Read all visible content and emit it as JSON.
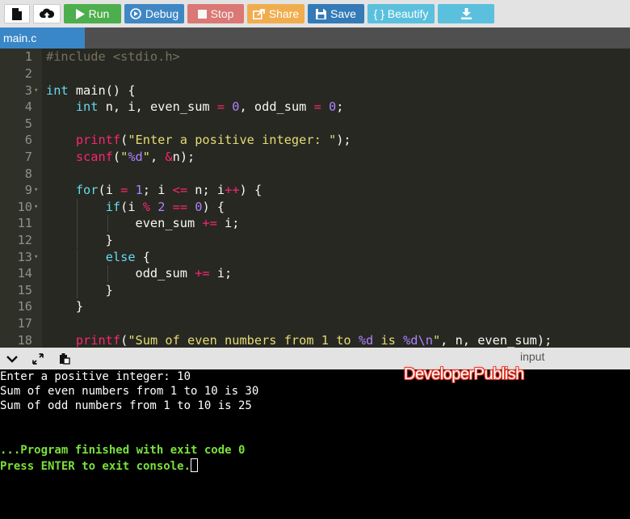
{
  "toolbar": {
    "run_label": "Run",
    "debug_label": "Debug",
    "stop_label": "Stop",
    "share_label": "Share",
    "save_label": "Save",
    "beautify_label": "{ } Beautify"
  },
  "tabs": [
    {
      "label": "main.c"
    }
  ],
  "editor": {
    "lines": [
      {
        "num": "1",
        "code": "#include <stdio.h>"
      },
      {
        "num": "2",
        "code": ""
      },
      {
        "num": "3",
        "code": "int main() {"
      },
      {
        "num": "4",
        "code": "    int n, i, even_sum = 0, odd_sum = 0;"
      },
      {
        "num": "5",
        "code": ""
      },
      {
        "num": "6",
        "code": "    printf(\"Enter a positive integer: \");"
      },
      {
        "num": "7",
        "code": "    scanf(\"%d\", &n);"
      },
      {
        "num": "8",
        "code": ""
      },
      {
        "num": "9",
        "code": "    for(i = 1; i <= n; i++) {"
      },
      {
        "num": "10",
        "code": "        if(i % 2 == 0) {"
      },
      {
        "num": "11",
        "code": "            even_sum += i;"
      },
      {
        "num": "12",
        "code": "        }"
      },
      {
        "num": "13",
        "code": "        else {"
      },
      {
        "num": "14",
        "code": "            odd_sum += i;"
      },
      {
        "num": "15",
        "code": "        }"
      },
      {
        "num": "16",
        "code": "    }"
      },
      {
        "num": "17",
        "code": ""
      },
      {
        "num": "18",
        "code": "    printf(\"Sum of even numbers from 1 to %d is %d\\n\", n, even_sum);"
      }
    ]
  },
  "console": {
    "input_label": "input",
    "lines": [
      "Enter a positive integer: 10",
      "Sum of even numbers from 1 to 10 is 30",
      "Sum of odd numbers from 1 to 10 is 25",
      "",
      "",
      "...Program finished with exit code 0",
      "Press ENTER to exit console."
    ]
  },
  "watermark": "DeveloperPublish",
  "colors": {
    "run": "#4cae4c",
    "debug": "#3f87c4",
    "stop": "#d9534f",
    "share": "#f0ad4e",
    "save": "#337ab7",
    "beautify": "#5bc0de",
    "editor_bg": "#272822",
    "console_green": "#7be03b"
  }
}
